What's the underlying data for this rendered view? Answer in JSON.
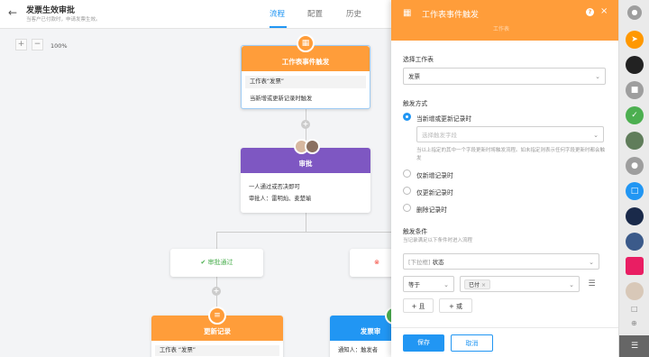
{
  "header": {
    "back_icon": "arrow-left-icon",
    "title": "发票生效审批",
    "subtitle": "当客户已付款时，申请发票生效。",
    "tabs": [
      "流程",
      "配置",
      "历史"
    ]
  },
  "canvas": {
    "zoom_minus": "−",
    "zoom_plus": "+",
    "zoom": "100%",
    "trigger_node": {
      "title": "工作表事件触发",
      "row1": "工作表“发票”",
      "row2": "当新增或更新记录时触发"
    },
    "approval_node": {
      "title": "审批",
      "row1": "一人通过或否决即可",
      "row2": "审批人：雷明灿、麦楚瑜"
    },
    "branch_pass": "审批通过",
    "branch_reject_icon": "x-circle-icon",
    "update_node": {
      "title": "更新记录",
      "row1": "工作表 “发票”"
    },
    "invoice_node": {
      "title": "发票审",
      "row1": "通知人：触发者"
    }
  },
  "panel": {
    "title": "工作表事件触发",
    "subtitle": "工作表",
    "help": "?",
    "close": "×",
    "select_sheet_label": "选择工作表",
    "sheet_value": "发票",
    "trigger_mode_label": "触发方式",
    "radio_options": [
      "当新增或更新记录时",
      "仅新增记录时",
      "仅更新记录时",
      "删除记录时"
    ],
    "field_placeholder": "选择触发字段",
    "hint": "当以上指定的其中一个字段更新时将触发流程。如未指定则表示任何字段更新时都会触发",
    "condition_label": "触发条件",
    "condition_hint": "当记录满足以下条件时进入流程",
    "condition_field_prefix": "[下拉框]",
    "condition_field": "状态",
    "operator": "等于",
    "value_tag": "已付",
    "add_and": "+ 且",
    "add_or": "+ 或",
    "save": "保存",
    "cancel": "取消"
  },
  "colors": {
    "accent": "#2196f3",
    "trigger_orange": "#ff9d3a",
    "approval_purple": "#7e57c2",
    "pass_green": "#4caf50",
    "reject_red": "#f44336"
  }
}
